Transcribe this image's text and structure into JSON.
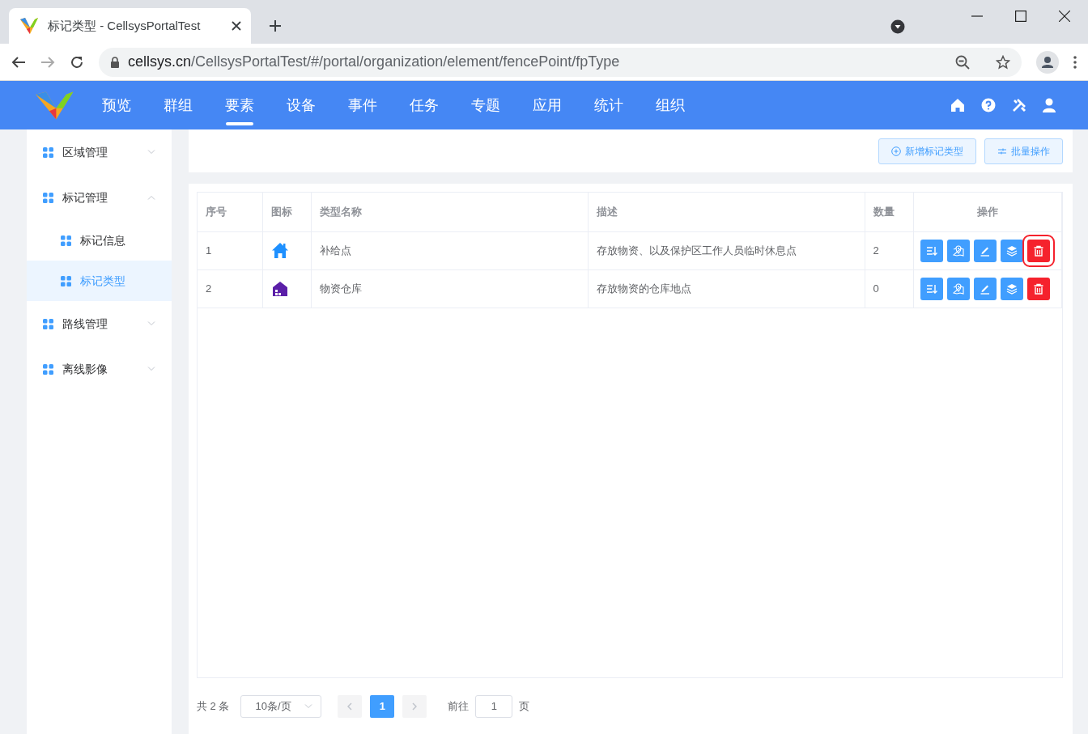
{
  "browser": {
    "tab_title": "标记类型 - CellsysPortalTest",
    "url_host": "cellsys.cn",
    "url_path": "/CellsysPortalTest/#/portal/organization/element/fencePoint/fpType"
  },
  "nav": {
    "items": [
      {
        "label": "预览",
        "selected": false
      },
      {
        "label": "群组",
        "selected": false
      },
      {
        "label": "要素",
        "selected": true
      },
      {
        "label": "设备",
        "selected": false
      },
      {
        "label": "事件",
        "selected": false
      },
      {
        "label": "任务",
        "selected": false
      },
      {
        "label": "专题",
        "selected": false
      },
      {
        "label": "应用",
        "selected": false
      },
      {
        "label": "统计",
        "selected": false
      },
      {
        "label": "组织",
        "selected": false
      }
    ]
  },
  "sidebar": {
    "items": [
      {
        "label": "区域管理",
        "expanded": false,
        "selected": false
      },
      {
        "label": "标记管理",
        "expanded": true,
        "selected": false,
        "children": [
          {
            "label": "标记信息",
            "selected": false
          },
          {
            "label": "标记类型",
            "selected": true
          }
        ]
      },
      {
        "label": "路线管理",
        "expanded": false,
        "selected": false
      },
      {
        "label": "离线影像",
        "expanded": false,
        "selected": false
      }
    ]
  },
  "toolbar": {
    "buttons": [
      {
        "label": "新增标记类型",
        "kind": "add"
      },
      {
        "label": "批量操作",
        "kind": "batch"
      }
    ]
  },
  "table": {
    "columns": [
      "序号",
      "图标",
      "类型名称",
      "描述",
      "数量",
      "操作"
    ],
    "rows": [
      {
        "index": "1",
        "kind": "house",
        "color": "#1e90ff",
        "name": "补给点",
        "description": "存放物资、以及保护区工作人员临时休息点",
        "count": "2",
        "delete_highlighted": true
      },
      {
        "index": "2",
        "kind": "warehouse",
        "color": "#5b1fa8",
        "name": "物资仓库",
        "description": "存放物资的仓库地点",
        "count": "0",
        "delete_highlighted": false
      }
    ],
    "actions": [
      {
        "kind": "sort"
      },
      {
        "kind": "map"
      },
      {
        "kind": "edit"
      },
      {
        "kind": "layers"
      },
      {
        "kind": "delete"
      }
    ]
  },
  "pagination": {
    "total": "共 2 条",
    "page_size": "10条/页",
    "pages": [
      {
        "label": "1",
        "selected": true
      }
    ],
    "goto_label": "前往",
    "goto_value": "1",
    "page_suffix": "页"
  }
}
